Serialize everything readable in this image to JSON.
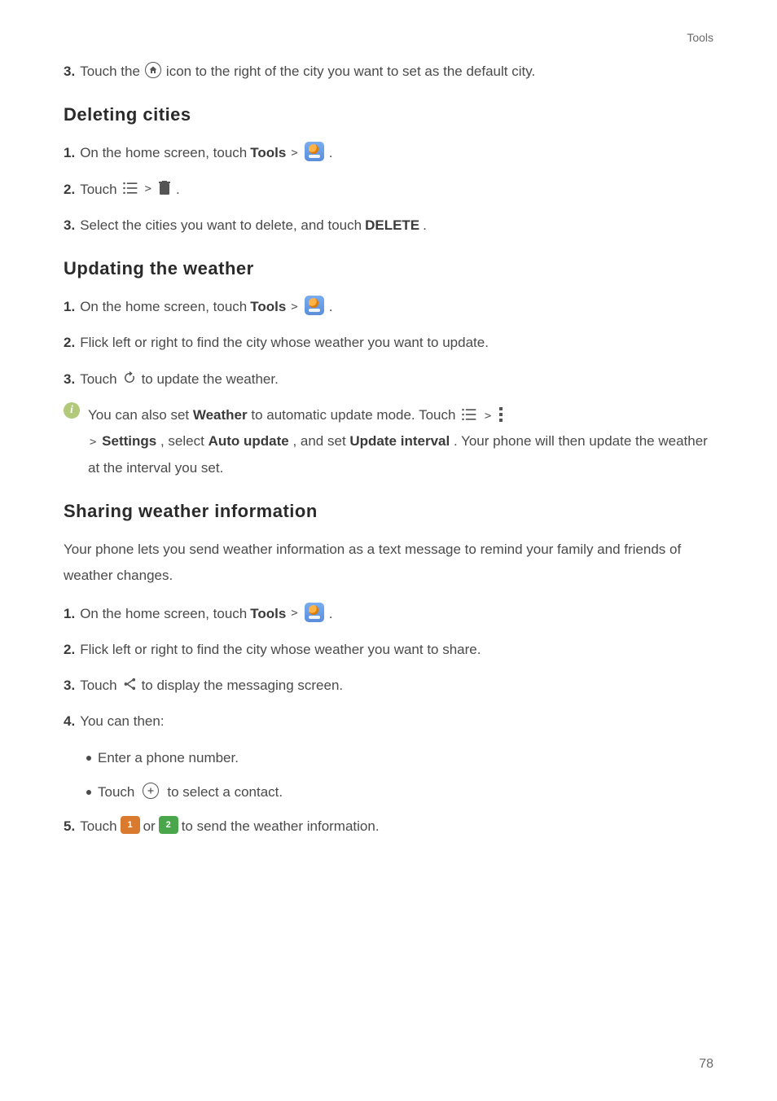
{
  "header": {
    "section": "Tools"
  },
  "step3_top": {
    "num": "3.",
    "pre": "Touch the ",
    "post": " icon to the right of the city you want to set as the default city."
  },
  "deleting": {
    "heading": "Deleting cities",
    "s1": {
      "num": "1.",
      "pre": "On the home screen, touch ",
      "tools": "Tools",
      "post": "."
    },
    "s2": {
      "num": "2.",
      "pre": "Touch ",
      "post": "."
    },
    "s3": {
      "num": "3.",
      "pre": "Select the cities you want to delete, and touch ",
      "bold": "DELETE",
      "post": "."
    }
  },
  "updating": {
    "heading": "Updating the weather",
    "s1": {
      "num": "1.",
      "pre": "On the home screen, touch ",
      "tools": "Tools",
      "post": "."
    },
    "s2": {
      "num": "2.",
      "text": "Flick left or right to find the city whose weather you want to update."
    },
    "s3": {
      "num": "3.",
      "pre": "Touch ",
      "post": " to update the weather."
    },
    "info": {
      "pre": "You can also set ",
      "weather": "Weather",
      "mid1": " to automatic update mode. Touch ",
      "gt": ">",
      "settings": "Settings",
      "mid2": ", select ",
      "auto": "Auto update",
      "mid3": ", and set ",
      "interval": "Update interval",
      "post": ". Your phone will then update the weather at the interval you set."
    }
  },
  "sharing": {
    "heading": "Sharing weather information",
    "intro": "Your phone lets you send weather information as a text message to remind your family and friends of weather changes.",
    "s1": {
      "num": "1.",
      "pre": "On the home screen, touch ",
      "tools": "Tools",
      "post": "."
    },
    "s2": {
      "num": "2.",
      "text": "Flick left or right to find the city whose weather you want to share."
    },
    "s3": {
      "num": "3.",
      "pre": "Touch ",
      "post": " to display the messaging screen."
    },
    "s4": {
      "num": "4.",
      "text": "You can then:"
    },
    "b1": "Enter a phone number.",
    "b2_pre": "Touch ",
    "b2_post": " to select a contact.",
    "s5": {
      "num": "5.",
      "pre": "Touch ",
      "mid": " or ",
      "post": " to send the weather information."
    },
    "sim1": "1",
    "sim2": "2"
  },
  "page_number": "78",
  "sep": ">"
}
